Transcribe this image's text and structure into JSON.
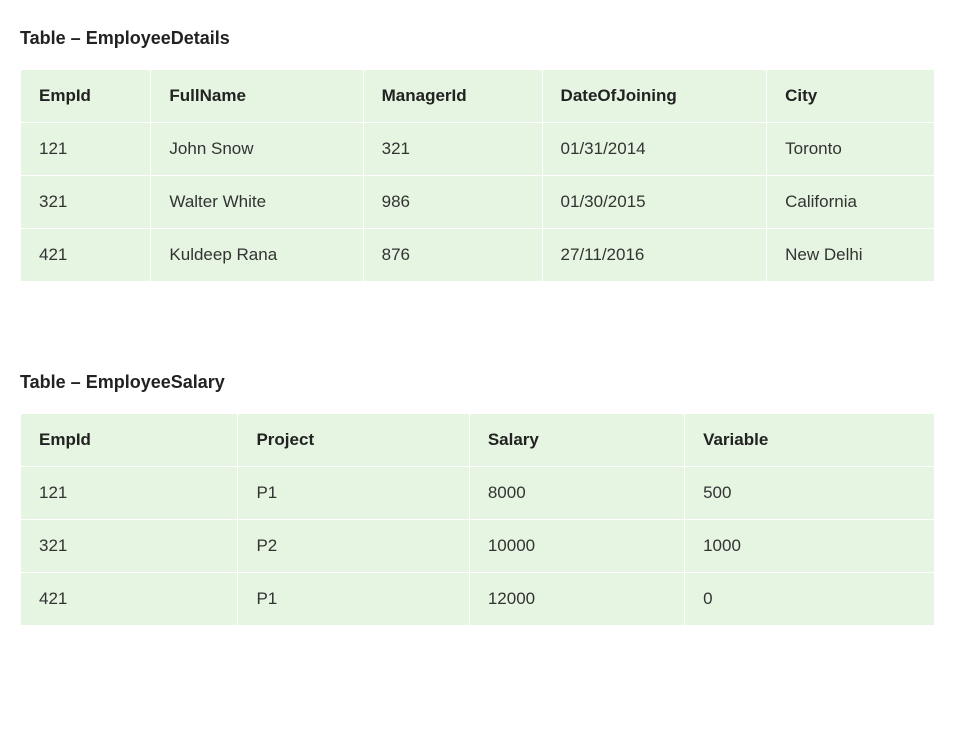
{
  "tables": [
    {
      "title": "Table – EmployeeDetails",
      "headers": [
        "EmpId",
        "FullName",
        "ManagerId",
        "DateOfJoining",
        "City"
      ],
      "rows": [
        [
          "121",
          "John Snow",
          "321",
          "01/31/2014",
          "Toronto"
        ],
        [
          "321",
          "Walter White",
          "986",
          "01/30/2015",
          "California"
        ],
        [
          "421",
          "Kuldeep Rana",
          "876",
          "27/11/2016",
          "New Delhi"
        ]
      ]
    },
    {
      "title": "Table – EmployeeSalary",
      "headers": [
        "EmpId",
        "Project",
        "Salary",
        "Variable"
      ],
      "rows": [
        [
          "121",
          "P1",
          "8000",
          "500"
        ],
        [
          "321",
          "P2",
          "10000",
          "1000"
        ],
        [
          "421",
          "P1",
          "12000",
          "0"
        ]
      ]
    }
  ]
}
